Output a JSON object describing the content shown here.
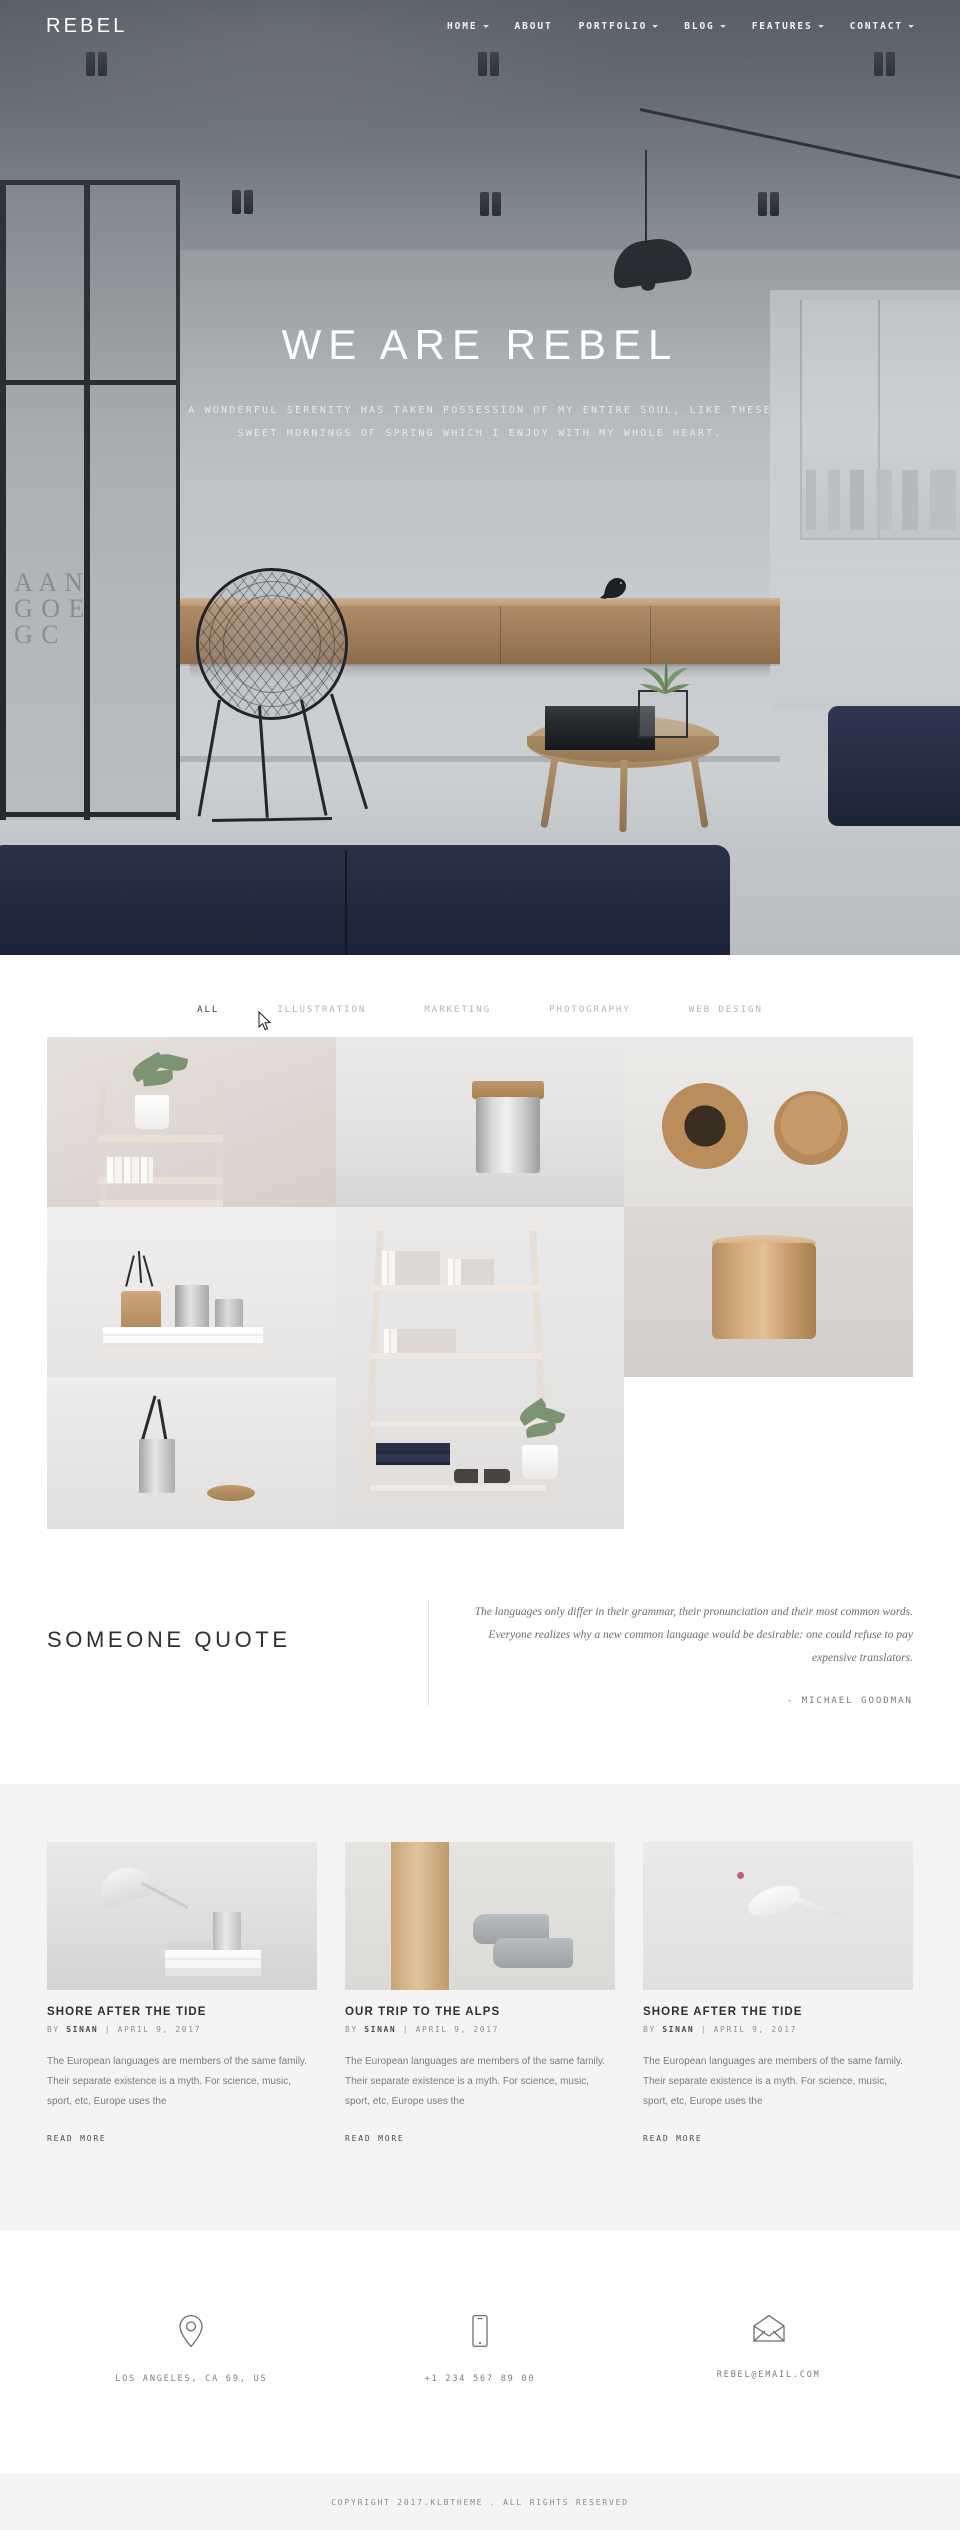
{
  "header": {
    "logo": "REBEL",
    "nav": [
      {
        "label": "HOME",
        "has_caret": true
      },
      {
        "label": "ABOUT",
        "has_caret": false
      },
      {
        "label": "PORTFOLIO",
        "has_caret": true
      },
      {
        "label": "BLOG",
        "has_caret": true
      },
      {
        "label": "FEATURES",
        "has_caret": true
      },
      {
        "label": "CONTACT",
        "has_caret": true
      }
    ]
  },
  "hero": {
    "title": "WE ARE REBEL",
    "subtitle_line1": "A WONDERFUL SERENITY HAS TAKEN POSSESSION OF MY ENTIRE SOUL, LIKE THESE",
    "subtitle_line2": "SWEET MORNINGS OF SPRING WHICH I ENJOY WITH MY WHOLE HEART."
  },
  "portfolio": {
    "filters": [
      {
        "label": "ALL",
        "active": true
      },
      {
        "label": "ILLUSTRATION",
        "active": false
      },
      {
        "label": "MARKETING",
        "active": false
      },
      {
        "label": "PHOTOGRAPHY",
        "active": false
      },
      {
        "label": "WEB DESIGN",
        "active": false
      }
    ]
  },
  "quote": {
    "title": "SOMEONE QUOTE",
    "text": "The languages only differ in their grammar, their pronunciation and their most common words. Everyone realizes why a new common language would be desirable: one could refuse to pay expensive translators.",
    "author": "- MICHAEL GOODMAN"
  },
  "blog": {
    "posts": [
      {
        "title": "SHORE AFTER THE TIDE",
        "meta_by": "BY",
        "meta_author": "SINAN",
        "meta_sep": "|",
        "meta_date": "APRIL 9, 2017",
        "excerpt": "The European languages are members of the same family. Their separate existence is a myth. For science, music, sport, etc, Europe uses the",
        "read_more": "READ MORE"
      },
      {
        "title": "OUR TRIP TO THE ALPS",
        "meta_by": "BY",
        "meta_author": "SINAN",
        "meta_sep": "|",
        "meta_date": "APRIL 9, 2017",
        "excerpt": "The European languages are members of the same family. Their separate existence is a myth. For science, music, sport, etc, Europe uses the",
        "read_more": "READ MORE"
      },
      {
        "title": "SHORE AFTER THE TIDE",
        "meta_by": "BY",
        "meta_author": "SINAN",
        "meta_sep": "|",
        "meta_date": "APRIL 9, 2017",
        "excerpt": "The European languages are members of the same family. Their separate existence is a myth. For science, music, sport, etc, Europe uses the",
        "read_more": "READ MORE"
      }
    ]
  },
  "contact": {
    "items": [
      {
        "icon": "map-pin-icon",
        "text": "LOS ANGELES, CA 69, US"
      },
      {
        "icon": "mobile-phone-icon",
        "text": "+1 234 567 89 00"
      },
      {
        "icon": "envelope-icon",
        "text": "REBEL@EMAIL.COM"
      }
    ]
  },
  "footer": {
    "copyright": "COPYRIGHT 2017.KLBTHEME . ALL RIGHTS RESERVED"
  },
  "colors": {
    "hero_overlay": "#404650",
    "text_dark": "#2f2f2f",
    "text_muted": "#8e8e8e",
    "section_bg": "#f4f4f4",
    "accent_navy": "#252d44"
  }
}
